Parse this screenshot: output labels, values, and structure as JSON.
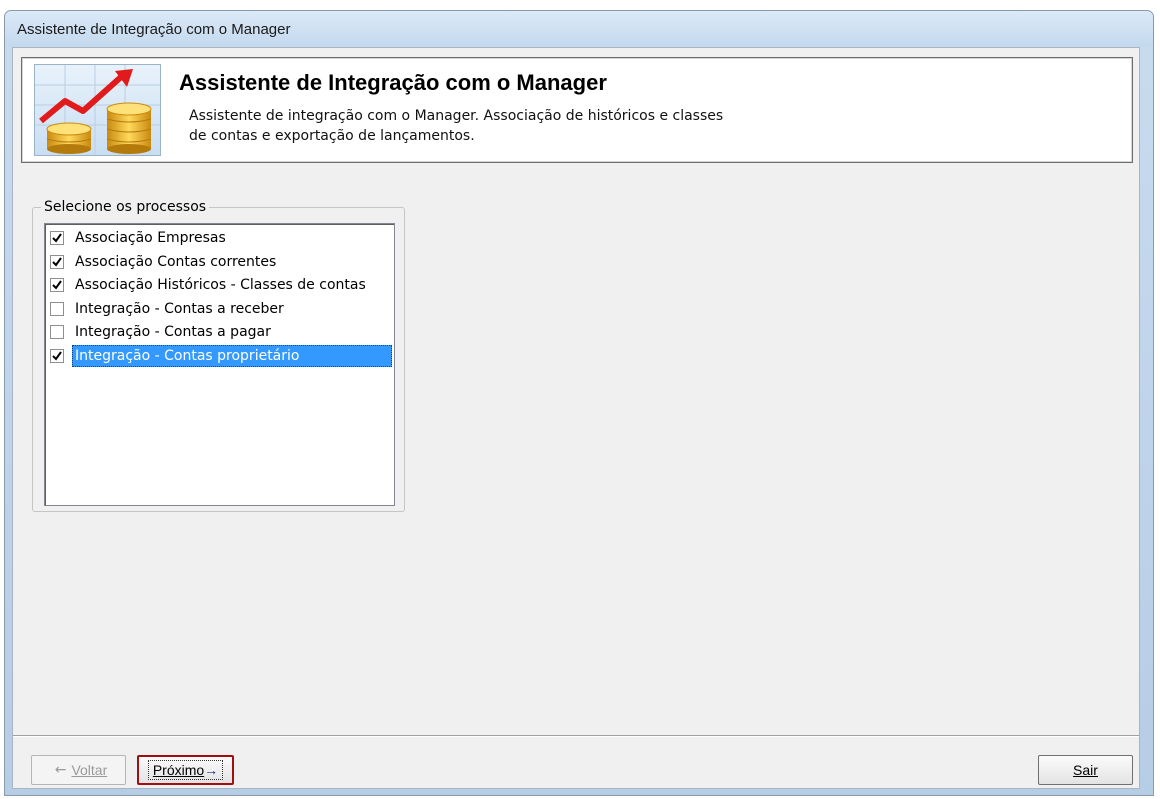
{
  "window": {
    "title": "Assistente de Integração com o Manager"
  },
  "banner": {
    "title": "Assistente de Integração com o Manager",
    "description_line1": "Assistente de integração com o Manager. Associação de históricos e classes",
    "description_line2": "de contas e exportação de lançamentos.",
    "image_icon": "chart-coins-icon"
  },
  "processes": {
    "legend": "Selecione os processos",
    "items": [
      {
        "label": "Associação Empresas",
        "checked": true,
        "selected": false
      },
      {
        "label": "Associação Contas correntes",
        "checked": true,
        "selected": false
      },
      {
        "label": "Associação Históricos - Classes de contas",
        "checked": true,
        "selected": false
      },
      {
        "label": "Integração - Contas a receber",
        "checked": false,
        "selected": false
      },
      {
        "label": "Integração - Contas a pagar",
        "checked": false,
        "selected": false
      },
      {
        "label": "Integração - Contas proprietário",
        "checked": true,
        "selected": true
      }
    ]
  },
  "buttons": {
    "back_label": "Voltar",
    "back_arrow": "←",
    "next_label": "Próximo",
    "next_arrow": "→",
    "exit_label": "Sair"
  },
  "colors": {
    "selection": "#3399ff",
    "next_button_border": "#a01010"
  }
}
